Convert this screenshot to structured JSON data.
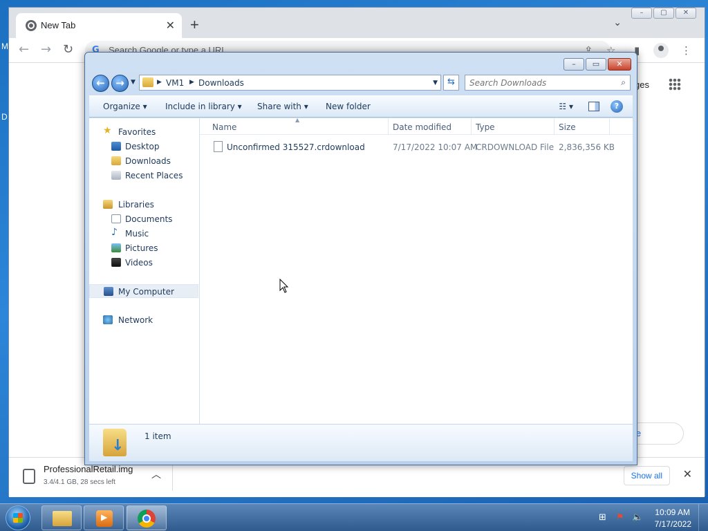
{
  "desktop": {
    "edge_letter_1": "M",
    "edge_letter_2": "D"
  },
  "chrome": {
    "tab_title": "New Tab",
    "tab_close": "✕",
    "new_tab": "+",
    "tab_search": "⌄",
    "window_controls": {
      "minimize": "–",
      "maximize": "▢",
      "close": "✕"
    },
    "nav": {
      "back": "←",
      "forward": "→",
      "reload": "↻"
    },
    "omnibox_g": "G",
    "omnibox_placeholder": "Search Google or type a URL",
    "share_icon": "⇪",
    "star_icon": "☆",
    "sidepanel_icon": "▮",
    "menu_icon": "⋮",
    "right_text": "ges",
    "customize_pill": "e Chrome"
  },
  "downloads_bar": {
    "file_name": "ProfessionalRetail.img",
    "status": "3.4/4.1 GB, 28 secs left",
    "chevron": "︿",
    "show_all": "Show all",
    "close": "✕"
  },
  "explorer": {
    "window_controls": {
      "minimize": "–",
      "maximize": "▭",
      "close": "✕"
    },
    "nav": {
      "back": "←",
      "forward": "→",
      "dropdown": "▼"
    },
    "breadcrumb": [
      "VM1",
      "Downloads"
    ],
    "breadcrumb_arrow": "▶",
    "address_dropdown": "▼",
    "refresh": "⇆",
    "search_placeholder": "Search Downloads",
    "search_icon": "⌕",
    "commands": {
      "organize": "Organize ▾",
      "include_in_library": "Include in library ▾",
      "share_with": "Share with ▾",
      "new_folder": "New folder"
    },
    "view_button": "☷ ▾",
    "help": "?",
    "nav_pane": {
      "favorites": "Favorites",
      "desktop": "Desktop",
      "downloads": "Downloads",
      "recent_places": "Recent Places",
      "libraries": "Libraries",
      "documents": "Documents",
      "music": "Music",
      "pictures": "Pictures",
      "videos": "Videos",
      "my_computer": "My Computer",
      "network": "Network"
    },
    "columns": {
      "name": "Name",
      "date_modified": "Date modified",
      "type": "Type",
      "size": "Size"
    },
    "sort_indicator": "▲",
    "files": [
      {
        "name": "Unconfirmed 315527.crdownload",
        "date_modified": "7/17/2022 10:07 AM",
        "type": "CRDOWNLOAD File",
        "size": "2,836,356 KB"
      }
    ],
    "item_count": "1 item"
  },
  "taskbar": {
    "tray": {
      "network": "⊞",
      "flag": "⚑",
      "volume": "🔈"
    },
    "time": "10:09 AM",
    "date": "7/17/2022"
  }
}
